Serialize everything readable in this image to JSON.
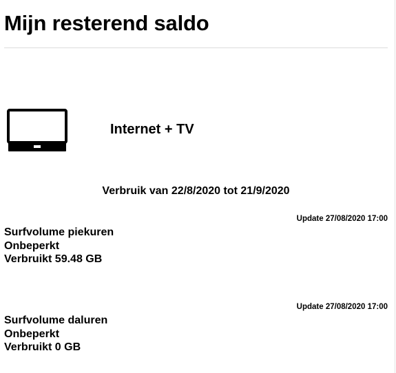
{
  "page": {
    "title": "Mijn resterend saldo"
  },
  "product": {
    "icon": "tv-icon",
    "name": "Internet + TV"
  },
  "period_label": "Verbruik van 22/8/2020 tot 21/9/2020",
  "usage": [
    {
      "update": "Update 27/08/2020 17:00",
      "label": "Surfvolume piekuren",
      "limit": "Onbeperkt",
      "used": "Verbruikt 59.48 GB"
    },
    {
      "update": "Update 27/08/2020 17:00",
      "label": "Surfvolume daluren",
      "limit": "Onbeperkt",
      "used": "Verbruikt 0 GB"
    }
  ]
}
